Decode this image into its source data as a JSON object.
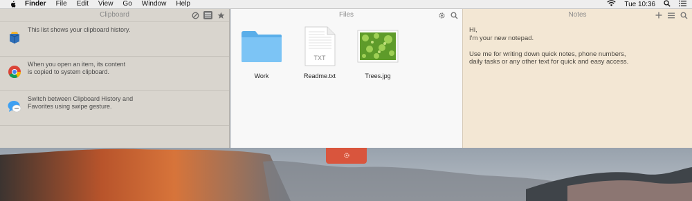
{
  "menubar": {
    "apple_icon": "apple-icon",
    "items": [
      "Finder",
      "File",
      "Edit",
      "View",
      "Go",
      "Window",
      "Help"
    ],
    "clock": "Tue 10:36",
    "right_icons": [
      "wifi-icon",
      "spotlight-search-icon",
      "notification-center-icon"
    ]
  },
  "clipboard": {
    "title": "Clipboard",
    "toolbar_icons": [
      "clear-icon",
      "history-list-icon",
      "favorites-star-icon"
    ],
    "items": [
      {
        "icon": "box-app-icon",
        "text": "This list shows your clipboard history."
      },
      {
        "icon": "chrome-icon",
        "text": "When you open an item, its content\nis copied to system clipboard."
      },
      {
        "icon": "messages-icon",
        "text": "Switch between Clipboard History and\nFavorites using swipe gesture."
      }
    ]
  },
  "files": {
    "title": "Files",
    "toolbar_icons": [
      "gear-icon",
      "search-icon"
    ],
    "items": [
      {
        "name": "Work",
        "type": "folder"
      },
      {
        "name": "Readme.txt",
        "type": "text",
        "badge": "TXT"
      },
      {
        "name": "Trees.jpg",
        "type": "image"
      }
    ]
  },
  "notes": {
    "title": "Notes",
    "toolbar_icons": [
      "add-icon",
      "list-icon",
      "search-icon"
    ],
    "text": "Hi,\nI'm your new notepad.\n\nUse me for writing down quick notes, phone numbers,\ndaily tasks or any other text for quick and easy access."
  },
  "handle": {
    "icon": "gear-icon"
  },
  "colors": {
    "menubar_bg": "#eeeeee",
    "clipboard_bg": "#d9d5ce",
    "files_bg": "#f8f8f8",
    "notes_bg": "#f3e7d4",
    "handle_bg": "#d9553d",
    "folder_blue": "#6fbdf2"
  }
}
